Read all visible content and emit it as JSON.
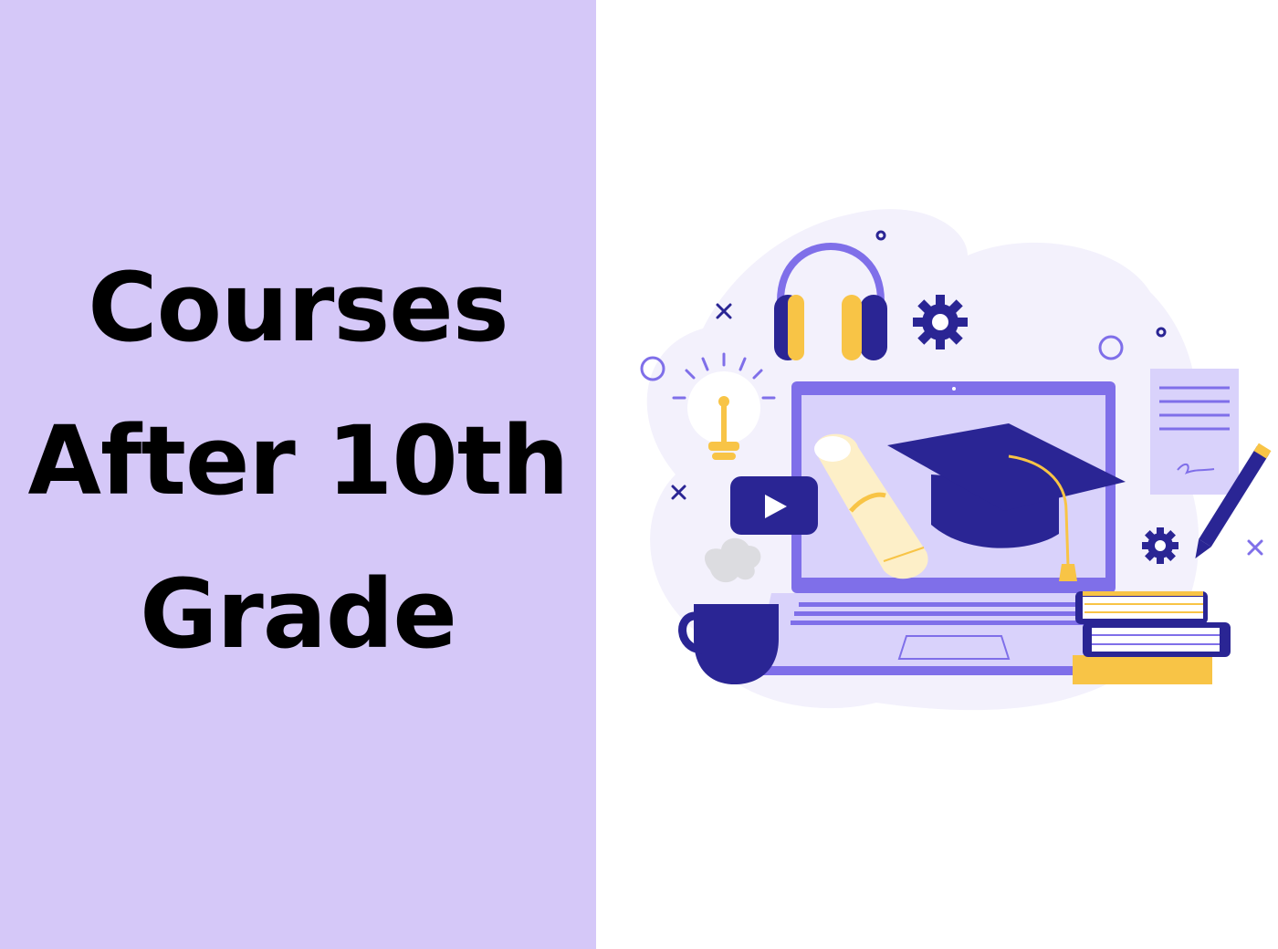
{
  "title_lines": [
    "Courses",
    "After 10th",
    "Grade"
  ],
  "colors": {
    "panel": "#d5c8f8",
    "navy": "#2a2594",
    "purple": "#7f6fe9",
    "light_purple": "#d9d2fb",
    "blob": "#f2f0fc",
    "yellow": "#f8c446",
    "cream": "#fdefc8",
    "grey_cloud": "#dcdce0"
  },
  "illustration": {
    "icons": [
      "headphones-icon",
      "gear-icon",
      "gear-small-icon",
      "lightbulb-icon",
      "play-video-icon",
      "graduation-cap-icon",
      "diploma-scroll-icon",
      "coffee-mug-icon",
      "laptop-icon",
      "books-stack-icon",
      "document-icon",
      "pencil-icon"
    ]
  }
}
